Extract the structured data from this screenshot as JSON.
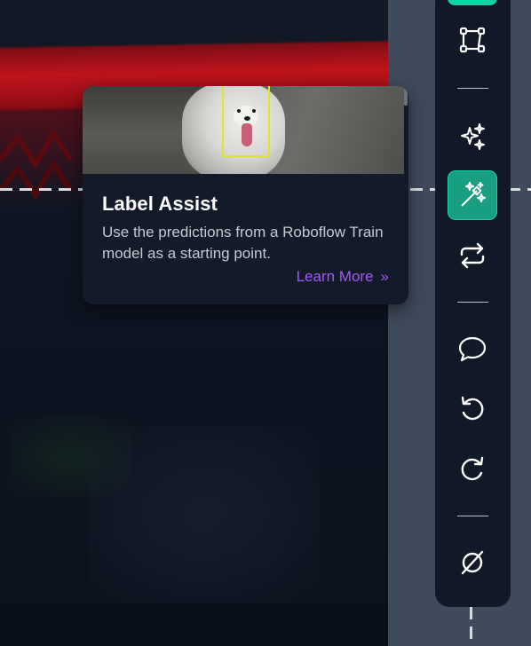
{
  "tooltip": {
    "title": "Label Assist",
    "description": "Use the predictions from a Roboflow Train model as a starting point.",
    "link_label": "Learn More",
    "link_icon": "»"
  },
  "toolbar": {
    "tools": [
      {
        "name": "polygon-tool",
        "icon": "polygon-icon",
        "active": false
      },
      {
        "name": "smart-polygon-tool",
        "icon": "sparkles-icon",
        "active": false
      },
      {
        "name": "label-assist-tool",
        "icon": "magic-wand-icon",
        "active": true
      },
      {
        "name": "repeat-previous-tool",
        "icon": "repeat-icon",
        "active": false
      },
      {
        "name": "comment-tool",
        "icon": "comment-icon",
        "active": false
      },
      {
        "name": "undo-tool",
        "icon": "undo-icon",
        "active": false
      },
      {
        "name": "redo-tool",
        "icon": "redo-icon",
        "active": false
      },
      {
        "name": "null-tool",
        "icon": "null-icon",
        "active": false
      }
    ]
  },
  "colors": {
    "accent": "#15d1a6",
    "active_tool_bg": "#1a9e82",
    "toolbar_bg": "#111827",
    "link": "#a855f7",
    "bbox": "#e3e22a",
    "side_panel": "#3f4a5c"
  }
}
